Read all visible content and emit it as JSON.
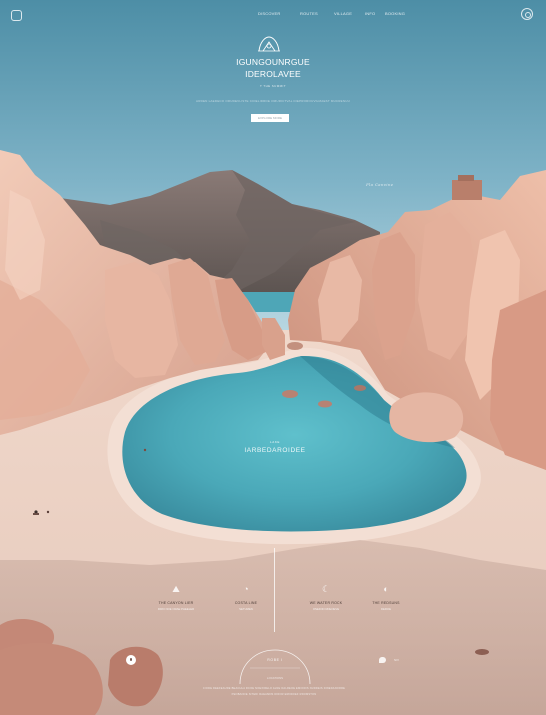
{
  "nav": {
    "items": [
      {
        "label": "DISCOVER"
      },
      {
        "label": "ROUTES"
      },
      {
        "label": "VILLAGE"
      },
      {
        "label": "INFO"
      },
      {
        "label": "BOOKING"
      }
    ]
  },
  "hero": {
    "title_line1": "IGUNGOUNRGUE",
    "title_line2": "IDEROLAVEE",
    "caption": "T  THE  SUMMIT",
    "subtitle": "ARDEN LAEDECO  ORUDEVLISTE CIOELIDRDE OMURICTVAL DIEPROROUVILMAEST MUCRENUU",
    "button_label": "EXPLORE MORE"
  },
  "side_caption": "Pla  Canvine",
  "lake": {
    "small": "LAKE",
    "big": "IARBEDAROIDEE"
  },
  "features": [
    {
      "icon": "hiking-icon",
      "glyph": "⛰",
      "name": "THE CANYON LIER",
      "desc": "IDRO NOE ORAE PHEELER"
    },
    {
      "icon": "compass-icon",
      "glyph": "◔",
      "name": "COSTA LINE",
      "desc": "SETUMEN"
    },
    {
      "icon": "spiral-icon",
      "glyph": "☾",
      "name": "WE WATER ROCK",
      "desc": "ONEDIIO RDEOEVE"
    },
    {
      "icon": "sun-icon",
      "glyph": "◐",
      "name": "THE REDSUNS",
      "desc": "DEROE"
    }
  ],
  "bottom": {
    "arch_label": "ROBE  I",
    "arch_sub": "LOCATIONS",
    "footer_line1": "CIODE DEEFEAUDE  BEACHLA  RCOE  NOEXIRELO  ALNE DALREOE  EMONOS  NUDDEIS  DINEDANORRE",
    "footer_line2": "PEOBANOE  SITEDI RAEAMNS  DIROR ERNDOEF  RDOMSTON"
  },
  "chat_label": "NIV"
}
